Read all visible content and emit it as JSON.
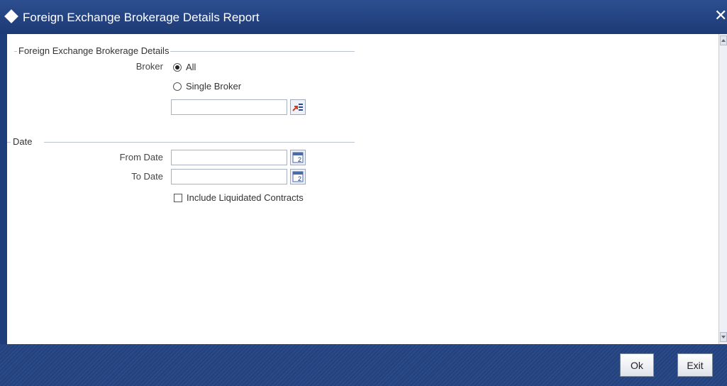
{
  "window": {
    "title": "Foreign Exchange Brokerage Details Report",
    "close_symbol": "✕"
  },
  "sections": {
    "brokerage": {
      "title": "Foreign Exchange Brokerage Details"
    },
    "date": {
      "title": "Date"
    }
  },
  "broker": {
    "label": "Broker",
    "options": [
      {
        "label": "All",
        "selected": true
      },
      {
        "label": "Single Broker",
        "selected": false
      }
    ],
    "broker_code_value": ""
  },
  "date": {
    "from_label": "From Date",
    "from_value": "",
    "to_label": "To Date",
    "to_value": "",
    "calendar_glyph": "2"
  },
  "include_liquidated": {
    "label": "Include Liquidated Contracts",
    "checked": false
  },
  "footer": {
    "ok_label": "Ok",
    "exit_label": "Exit"
  },
  "colors": {
    "titlebar": "#1c3a75",
    "footer": "#23417c",
    "lov_arrow": "#d23a1e"
  }
}
